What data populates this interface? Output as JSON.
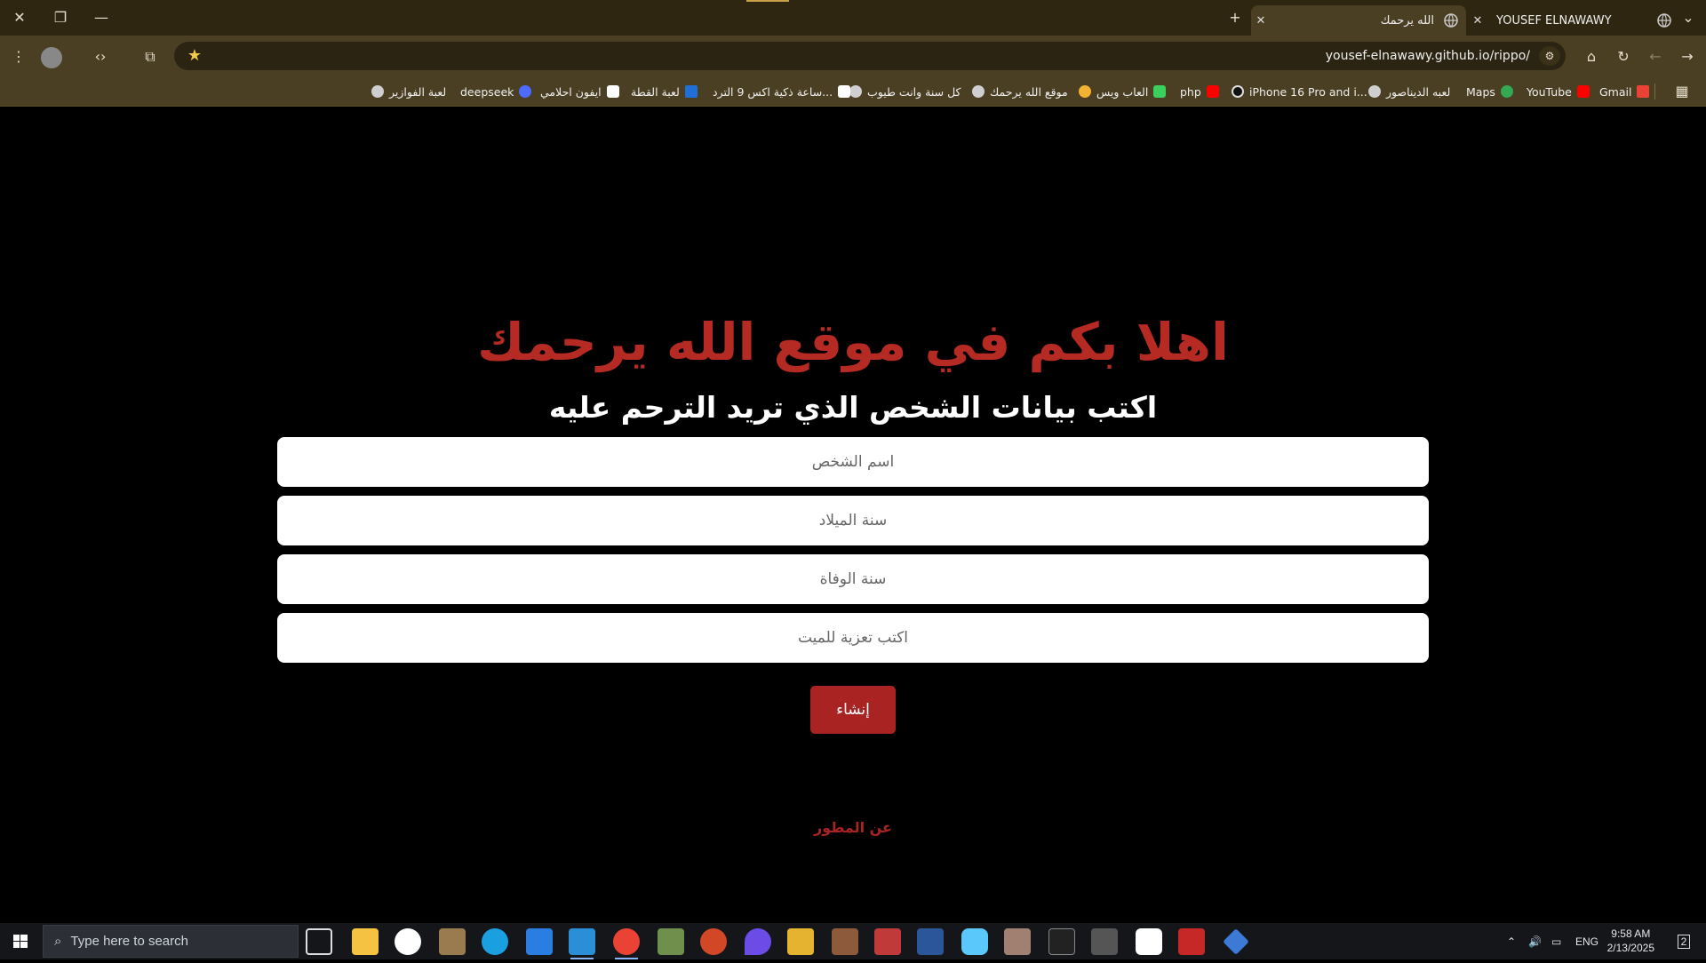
{
  "browser": {
    "tabs": [
      {
        "title": "YOUSEF ELNAWAWY",
        "active": false
      },
      {
        "title": "الله يرحمك",
        "active": true
      }
    ],
    "url": "yousef-elnawawy.github.io/rippo/"
  },
  "bookmarks": [
    {
      "label": "Gmail",
      "icon": "gmail-icon"
    },
    {
      "label": "YouTube",
      "icon": "youtube-icon"
    },
    {
      "label": "Maps",
      "icon": "maps-icon"
    },
    {
      "label": "لعبه الديناصور",
      "icon": "globe-icon"
    },
    {
      "label": "iPhone 16 Pro and i...",
      "icon": "apple-icon"
    },
    {
      "label": "php",
      "icon": "youtube-icon"
    },
    {
      "label": "العاب ويس",
      "icon": "game-icon"
    },
    {
      "label": "موقع الله يرحمك",
      "icon": "globe-icon"
    },
    {
      "label": "كل سنة وانت طيوب",
      "icon": "globe-icon"
    },
    {
      "label": "ساعة ذكية اكس 9 الترد...",
      "icon": "amazon-icon"
    },
    {
      "label": "لعبة القطة",
      "icon": "cartoon-network-icon"
    },
    {
      "label": "ايفون احلامي",
      "icon": "amazon-icon"
    },
    {
      "label": "deepseek",
      "icon": "deepseek-icon"
    },
    {
      "label": "لعبة الفوازير",
      "icon": "globe-icon"
    }
  ],
  "page": {
    "headline": "اهلا بكم في موقع الله يرحمك",
    "subheadline": "اكتب بيانات الشخص الذي تريد الترحم عليه",
    "fields": {
      "name_placeholder": "اسم الشخص",
      "birth_placeholder": "سنة الميلاد",
      "death_placeholder": "سنة الوفاة",
      "condolence_placeholder": "اكتب تعزية للميت"
    },
    "submit_label": "إنشاء",
    "about_link": "عن المطور",
    "accent_color": "#a82321"
  },
  "taskbar": {
    "search_placeholder": "Type here to search",
    "language": "ENG",
    "time": "9:58 AM",
    "date": "2/13/2025",
    "notifications": "2"
  }
}
